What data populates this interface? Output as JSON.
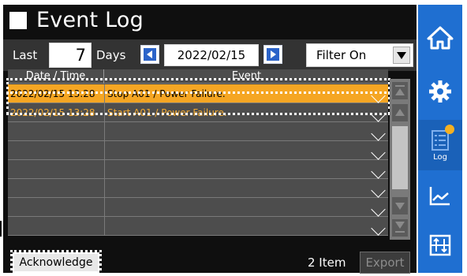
{
  "window": {
    "title": "Event Log"
  },
  "filter": {
    "last_label": "Last",
    "days_value": "7",
    "days_label": "Days",
    "date_value": "2022/02/15",
    "filter_value": "Filter On"
  },
  "table": {
    "columns": [
      "Date / Time",
      "Event"
    ],
    "rows": [
      {
        "datetime": "2022/02/15 13:28",
        "event": "Stop A01 / Power Failure.",
        "state": "selected"
      },
      {
        "datetime": "2022/02/15 13:28",
        "event": "Start A01 / Power Failure.",
        "state": "warning"
      },
      {
        "datetime": "",
        "event": "",
        "state": "empty"
      },
      {
        "datetime": "",
        "event": "",
        "state": "empty"
      },
      {
        "datetime": "",
        "event": "",
        "state": "empty"
      },
      {
        "datetime": "",
        "event": "",
        "state": "empty"
      },
      {
        "datetime": "",
        "event": "",
        "state": "empty"
      },
      {
        "datetime": "",
        "event": "",
        "state": "empty"
      }
    ]
  },
  "footer": {
    "acknowledge_label": "Acknowledge",
    "item_count": "2 Item",
    "export_label": "Export"
  },
  "nav": {
    "log_label": "Log"
  },
  "icons": {
    "home": "home-icon",
    "settings": "gear-icon",
    "log": "log-icon",
    "trend": "trend-chart-icon",
    "tuning": "tuning-icon"
  },
  "colors": {
    "selected_row": "#f5a623",
    "warning_text": "#f0a830",
    "nav_blue": "#1f6fd1",
    "arrow_blue": "#2b63c9"
  }
}
